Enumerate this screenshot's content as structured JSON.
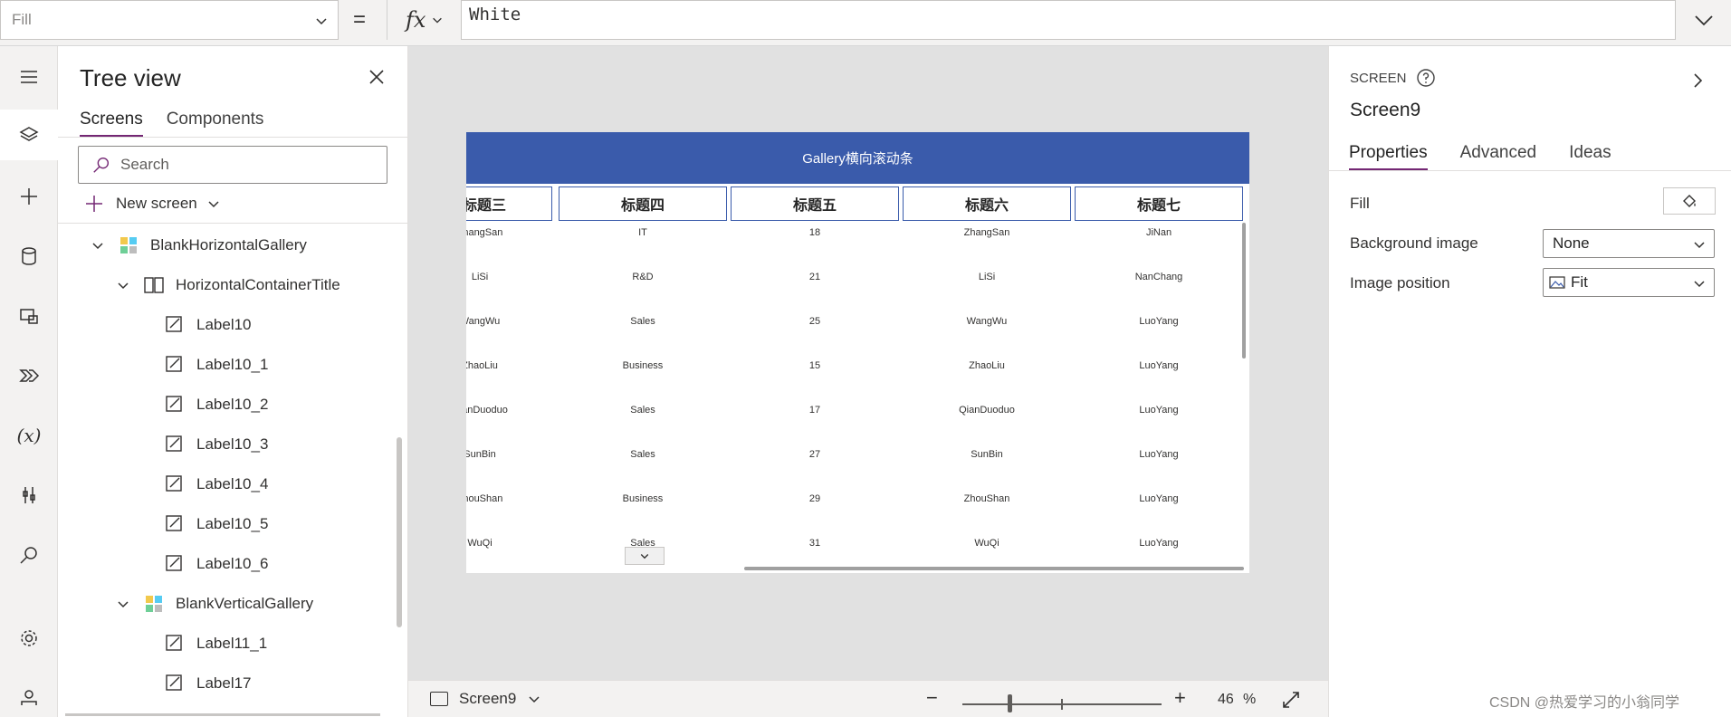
{
  "formula_bar": {
    "property": "Fill",
    "equals": "=",
    "fx": "fx",
    "formula": "White"
  },
  "tree_view": {
    "title": "Tree view",
    "tabs": [
      "Screens",
      "Components"
    ],
    "search_placeholder": "Search",
    "new_screen": "New screen",
    "items": [
      {
        "label": "BlankHorizontalGallery",
        "icon": "gallery-icon"
      },
      {
        "label": "HorizontalContainerTitle",
        "icon": "horizontal-container-icon"
      },
      {
        "label": "Label10",
        "icon": "label-icon"
      },
      {
        "label": "Label10_1",
        "icon": "label-icon"
      },
      {
        "label": "Label10_2",
        "icon": "label-icon"
      },
      {
        "label": "Label10_3",
        "icon": "label-icon"
      },
      {
        "label": "Label10_4",
        "icon": "label-icon"
      },
      {
        "label": "Label10_5",
        "icon": "label-icon"
      },
      {
        "label": "Label10_6",
        "icon": "label-icon"
      },
      {
        "label": "BlankVerticalGallery",
        "icon": "gallery-icon"
      },
      {
        "label": "Label11_1",
        "icon": "label-icon"
      },
      {
        "label": "Label17",
        "icon": "label-icon"
      }
    ]
  },
  "canvas": {
    "app_title": "Gallery横向滚动条",
    "columns": [
      "标题三",
      "标题四",
      "标题五",
      "标题六",
      "标题七"
    ],
    "rows": [
      [
        "ZhangSan",
        "IT",
        "18",
        "ZhangSan",
        "JiNan"
      ],
      [
        "LiSi",
        "R&D",
        "21",
        "LiSi",
        "NanChang"
      ],
      [
        "WangWu",
        "Sales",
        "25",
        "WangWu",
        "LuoYang"
      ],
      [
        "ZhaoLiu",
        "Business",
        "15",
        "ZhaoLiu",
        "LuoYang"
      ],
      [
        "QianDuoduo",
        "Sales",
        "17",
        "QianDuoduo",
        "LuoYang"
      ],
      [
        "SunBin",
        "Sales",
        "27",
        "SunBin",
        "LuoYang"
      ],
      [
        "ZhouShan",
        "Business",
        "29",
        "ZhouShan",
        "LuoYang"
      ],
      [
        "WuQi",
        "Sales",
        "31",
        "WuQi",
        "LuoYang"
      ]
    ],
    "header_color": "#3a5bab"
  },
  "status_bar": {
    "screen": "Screen9",
    "zoom_minus": "−",
    "zoom_plus": "+",
    "zoom_value": "46",
    "zoom_unit": "%"
  },
  "properties": {
    "type": "SCREEN",
    "name": "Screen9",
    "tabs": [
      "Properties",
      "Advanced",
      "Ideas"
    ],
    "fill_label": "Fill",
    "background_image_label": "Background image",
    "background_image_value": "None",
    "image_position_label": "Image position",
    "image_position_value": "Fit"
  },
  "watermark": "CSDN @热爱学习的小翁同学",
  "colors": {
    "accent": "#742774",
    "header": "#3a5bab"
  }
}
